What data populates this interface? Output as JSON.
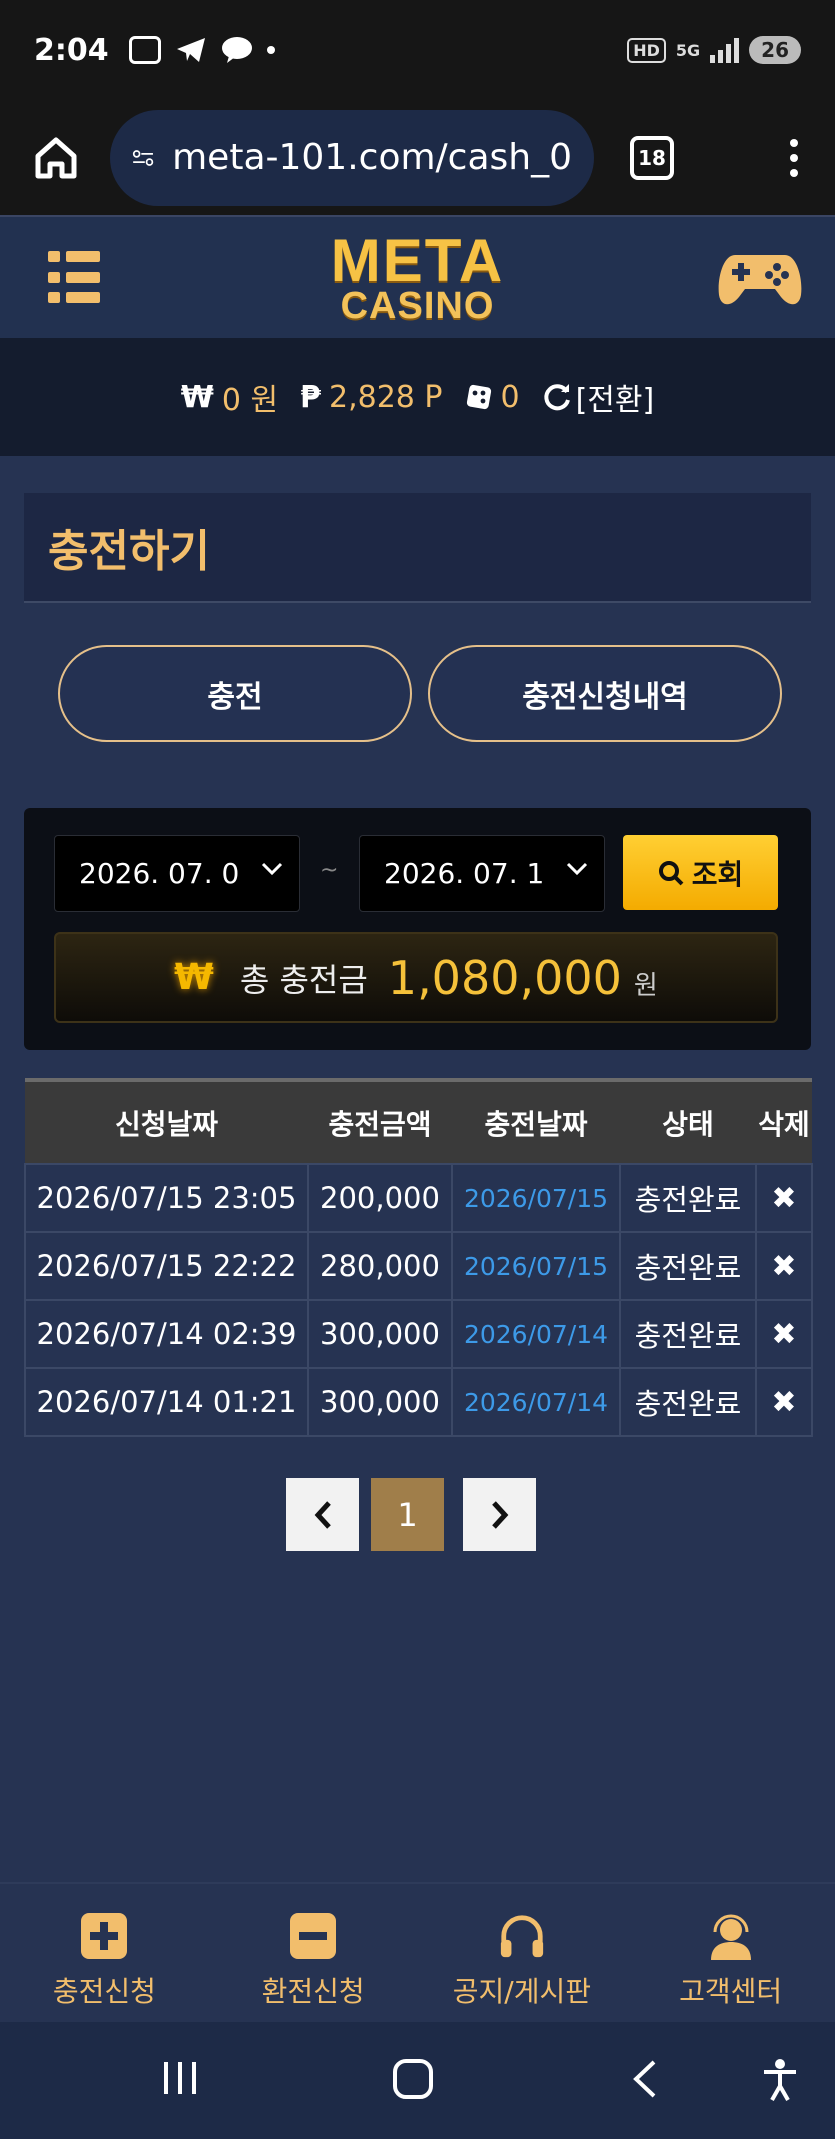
{
  "status_bar": {
    "time": "2:04",
    "battery": "26",
    "hd": "HD",
    "network": "5G"
  },
  "browser": {
    "url": "meta-101.com/cash_0",
    "tab_count": "18"
  },
  "header": {
    "logo_top": "META",
    "logo_bottom": "CASINO"
  },
  "balance": {
    "won_symbol": "₩",
    "won_value": "0 원",
    "point_symbol": "₱",
    "point_value": "2,828 P",
    "chip_value": "0",
    "convert_label": "[전환]"
  },
  "page": {
    "title": "충전하기",
    "tabs": [
      "충전",
      "충전신청내역"
    ]
  },
  "filter": {
    "date_from": "2026. 07. 0",
    "separator": "~",
    "date_to": "2026. 07. 1",
    "search_label": "조회",
    "total_symbol": "₩",
    "total_label": "총 충전금",
    "total_value": "1,080,000",
    "total_unit": "원"
  },
  "table": {
    "headers": [
      "신청날짜",
      "충전금액",
      "충전날짜",
      "상태",
      "삭제"
    ],
    "rows": [
      {
        "apply_date": "2026/07/15 23:05",
        "amount": "200,000",
        "done_date": "2026/07/15",
        "status": "충전완료",
        "delete": "✖"
      },
      {
        "apply_date": "2026/07/15 22:22",
        "amount": "280,000",
        "done_date": "2026/07/15",
        "status": "충전완료",
        "delete": "✖"
      },
      {
        "apply_date": "2026/07/14 02:39",
        "amount": "300,000",
        "done_date": "2026/07/14",
        "status": "충전완료",
        "delete": "✖"
      },
      {
        "apply_date": "2026/07/14 01:21",
        "amount": "300,000",
        "done_date": "2026/07/14",
        "status": "충전완료",
        "delete": "✖"
      }
    ]
  },
  "pagination": {
    "current": "1"
  },
  "bottom_nav": [
    {
      "label": "충전신청",
      "icon": "plus-square-icon"
    },
    {
      "label": "환전신청",
      "icon": "minus-square-icon"
    },
    {
      "label": "공지/게시판",
      "icon": "headphones-icon"
    },
    {
      "label": "고객센터",
      "icon": "support-agent-icon"
    }
  ],
  "colors": {
    "accent": "#f2be6c",
    "background": "#263352",
    "search_button": "#f4ab00",
    "link_date": "#3d9ae8"
  }
}
